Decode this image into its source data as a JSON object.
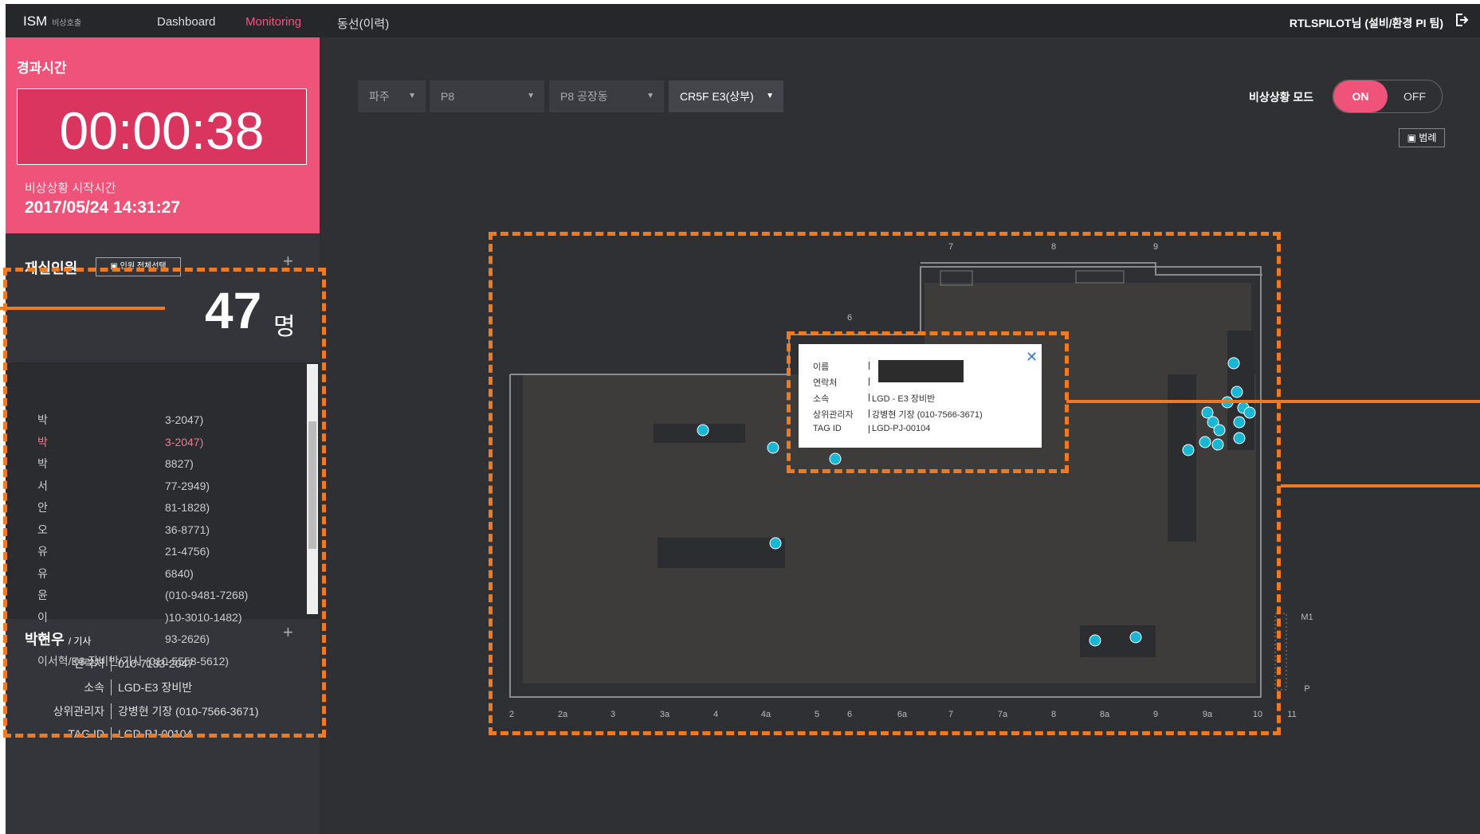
{
  "topbar": {
    "logo": "ISM",
    "logo_sub": "비상호출",
    "nav": [
      "Dashboard",
      "Monitoring",
      "동선(이력)"
    ],
    "user": "RTLSPILOT님 (설비/환경 PI 팀)",
    "logout_icon": "logout-icon"
  },
  "elapsed": {
    "title": "경과시간",
    "timer": "00:00:38",
    "start_label": "비상상황 시작시간",
    "start_time": "2017/05/24 14:31:27"
  },
  "occupancy": {
    "title": "재실인원",
    "select_all": "인원 전체선택",
    "count": "47",
    "unit": "명"
  },
  "list": [
    {
      "name": "박",
      "info": "3-2047)"
    },
    {
      "name": "박",
      "info": "3-2047)"
    },
    {
      "name": "박",
      "info": "8827)"
    },
    {
      "name": "서",
      "info": "77-2949)"
    },
    {
      "name": "안",
      "info": "81-1828)"
    },
    {
      "name": "오",
      "info": "36-8771)"
    },
    {
      "name": "유",
      "info": "21-4756)"
    },
    {
      "name": "유",
      "info": "6840)"
    },
    {
      "name": "윤",
      "info": "(010-9481-7268)"
    },
    {
      "name": "이",
      "info": ")10-3010-1482)"
    },
    {
      "name": "이",
      "info": "93-2626)"
    },
    {
      "name": "이서혁/E3 장비반/기사 (010-5558-5612)",
      "info": ""
    }
  ],
  "detail": {
    "name": "박현우",
    "title": "/ 기사",
    "rows": [
      {
        "k": "연락처",
        "v": "010-7133-2047"
      },
      {
        "k": "소속",
        "v": "LGD-E3 장비반"
      },
      {
        "k": "상위관리자",
        "v": "강병현 기장 (010-7566-3671)"
      },
      {
        "k": "TAG ID",
        "v": "LGD-PJ-00104"
      }
    ]
  },
  "filters": [
    "파주",
    "P8",
    "P8 공장동",
    "CR5F E3(상부)"
  ],
  "mode": {
    "label": "비상상황 모드",
    "on": "ON",
    "off": "OFF"
  },
  "legend_btn": "범례",
  "popup": {
    "rows": [
      {
        "k": "이름",
        "v": ""
      },
      {
        "k": "연락처",
        "v": ""
      },
      {
        "k": "소속",
        "v": "LGD - E3 장비반"
      },
      {
        "k": "상위관리자",
        "v": "강병현 기장 (010-7566-3671)"
      },
      {
        "k": "TAG ID",
        "v": "LGD-PJ-00104"
      }
    ]
  },
  "map": {
    "top_labels": [
      "7",
      "8",
      "9"
    ],
    "label_6": "6",
    "bottom_labels": [
      "2",
      "2a",
      "3",
      "3a",
      "4",
      "4a",
      "5",
      "6",
      "6a",
      "7",
      "7a",
      "8",
      "8a",
      "9",
      "9a",
      "10",
      "11"
    ],
    "side_labels": [
      "M1",
      "P"
    ],
    "marker_letter": "D",
    "marker_color": "#19b7d4",
    "highlight_color": "#f07a22",
    "accent_color": "#f0537a"
  }
}
